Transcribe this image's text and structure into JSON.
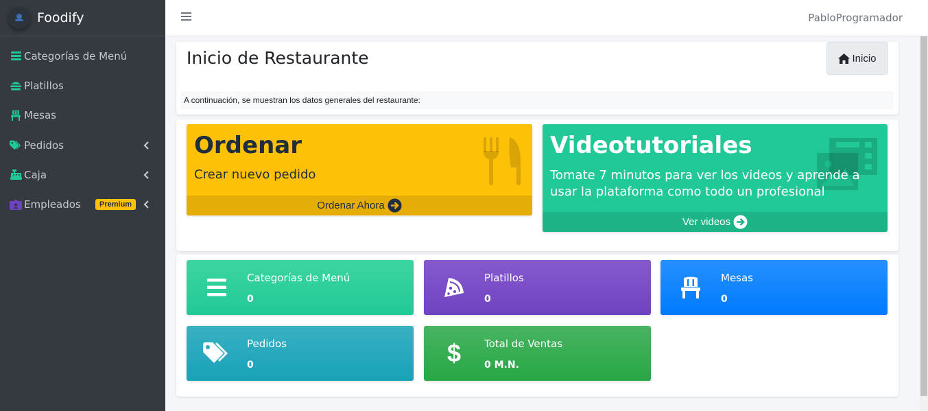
{
  "app": {
    "name": "Foodify"
  },
  "sidebar": {
    "items": [
      {
        "label": "Categorías de Menú",
        "icon": "list-icon",
        "has_submenu": false
      },
      {
        "label": "Platillos",
        "icon": "hamburger-icon",
        "has_submenu": false
      },
      {
        "label": "Mesas",
        "icon": "chair-icon",
        "has_submenu": false
      },
      {
        "label": "Pedidos",
        "icon": "tags-icon",
        "has_submenu": true
      },
      {
        "label": "Caja",
        "icon": "cash-register-icon",
        "has_submenu": true
      },
      {
        "label": "Empleados",
        "icon": "id-badge-icon",
        "has_submenu": true,
        "badge": "Premium"
      }
    ],
    "icon_color": "#20c997",
    "premium_icon_color": "#6f42c1",
    "badge_color": "#ffc107"
  },
  "topbar": {
    "menu_icon": "hamburger-menu-icon",
    "user": "PabloProgramador"
  },
  "header": {
    "title": "Inicio de Restaurante",
    "home_button": "Inicio",
    "intro": "A continuación, se muestran los datos generales del restaurante:"
  },
  "promos": {
    "order": {
      "title": "Ordenar",
      "text": "Crear nuevo pedido",
      "link": "Ordenar Ahora",
      "icon": "utensils-icon",
      "color": "#ffc107"
    },
    "videos": {
      "title": "Videotutoriales",
      "text": "Tomate 7 minutos para ver los videos y aprende a usar la plataforma como todo un profesional",
      "link": "Ver videos",
      "icon": "photo-video-icon",
      "color": "#20c997"
    }
  },
  "stats": [
    {
      "label": "Categorías de Menú",
      "value": "0",
      "icon": "list-icon",
      "color": "#20c997"
    },
    {
      "label": "Platillos",
      "value": "0",
      "icon": "pizza-slice-icon",
      "color": "#6f42c1"
    },
    {
      "label": "Mesas",
      "value": "0",
      "icon": "chair-icon",
      "color": "#007bff"
    },
    {
      "label": "Pedidos",
      "value": "0",
      "icon": "tags-icon",
      "color": "#17a2b8"
    },
    {
      "label": "Total de Ventas",
      "value": "0 M.N.",
      "icon": "dollar-icon",
      "color": "#28a745"
    }
  ]
}
